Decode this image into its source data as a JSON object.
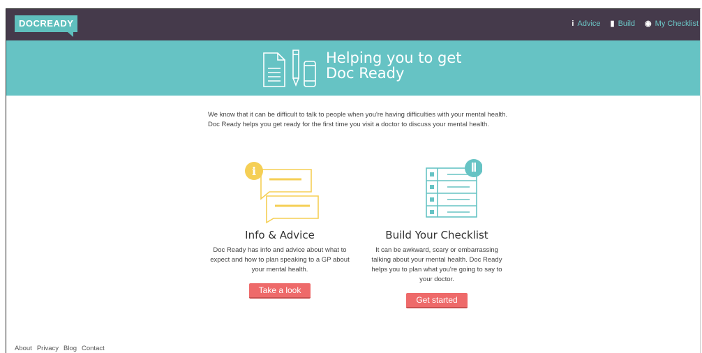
{
  "navbar": {
    "logo": "DOCREADY",
    "items": [
      {
        "icon": "info-icon",
        "glyph": "i",
        "label": "Advice"
      },
      {
        "icon": "build-icon",
        "glyph": "▮",
        "label": "Build"
      },
      {
        "icon": "eye-icon",
        "glyph": "👁",
        "label": "My Checklist"
      }
    ]
  },
  "hero": {
    "title_line1": "Helping you to get",
    "title_line2": "Doc Ready"
  },
  "intro": "We know that it can be difficult to talk to people when you're having difficulties with your mental health. Doc Ready helps you get ready for the first time you visit a doctor to discuss your mental health.",
  "columns": [
    {
      "title": "Info & Advice",
      "text": "Doc Ready has info and advice about what to expect and how to plan speaking to a GP about your mental health.",
      "button": "Take a look"
    },
    {
      "title": "Build Your Checklist",
      "text": "It can be awkward, scary or embarrassing talking about your mental health. Doc Ready helps you to plan what you're going to say to your doctor.",
      "button": "Get started"
    }
  ],
  "footer": [
    "About",
    "Privacy",
    "Blog",
    "Contact"
  ],
  "colors": {
    "navbar": "#453a4b",
    "teal": "#66c3c4",
    "button": "#ee6a6a",
    "yellow": "#f5cf55"
  }
}
